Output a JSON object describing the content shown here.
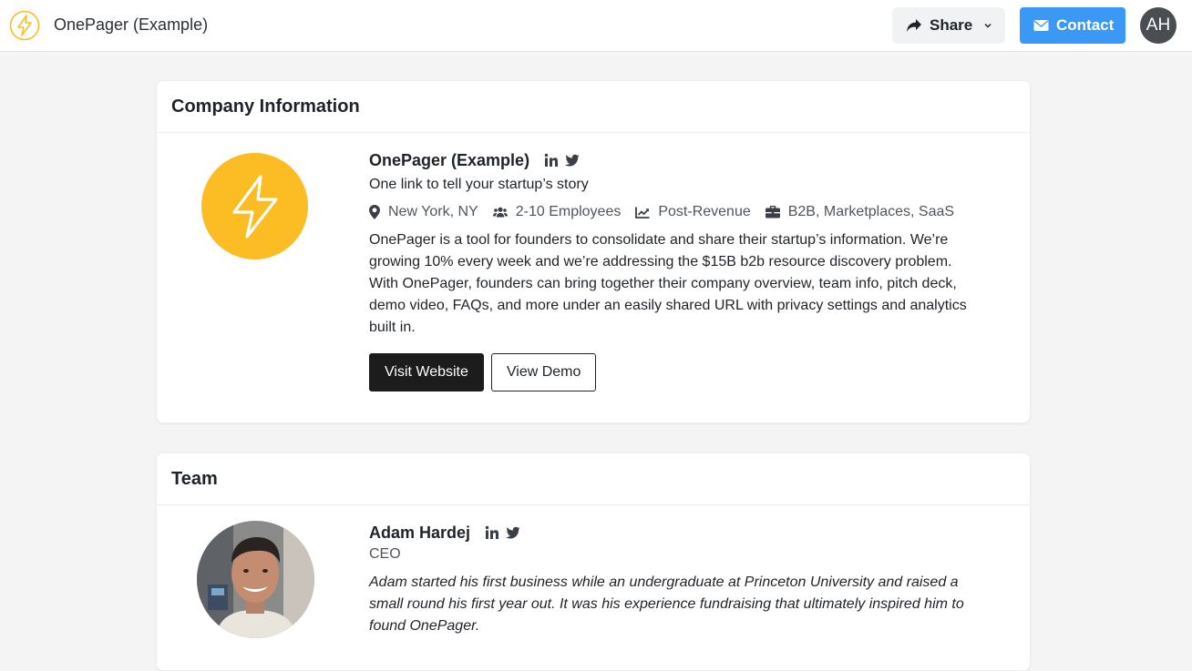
{
  "header": {
    "brand_name": "OnePager (Example)",
    "share_label": "Share",
    "contact_label": "Contact",
    "avatar_initials": "AH"
  },
  "company": {
    "section_title": "Company Information",
    "name": "OnePager (Example)",
    "tagline": "One link to tell your startup’s story",
    "location": "New York, NY",
    "employees": "2-10 Employees",
    "stage": "Post-Revenue",
    "industries": "B2B, Marketplaces, SaaS",
    "description": "OnePager is a tool for founders to consolidate and share their startup’s information. We’re growing 10% every week and we’re addressing the $15B b2b resource discovery problem. With OnePager, founders can bring together their company overview, team info, pitch deck, demo video, FAQs, and more under an easily shared URL with privacy settings and analytics built in.",
    "visit_website_label": "Visit Website",
    "view_demo_label": "View Demo"
  },
  "team": {
    "section_title": "Team",
    "members": [
      {
        "name": "Adam Hardej",
        "role": "CEO",
        "bio": "Adam started his first business while an undergraduate at Princeton University and raised a small round his first year out. It was his experience fundraising that ultimately inspired him to found OnePager."
      }
    ]
  },
  "colors": {
    "brand_yellow": "#fbbd23",
    "contact_blue": "#3b99f6",
    "primary_dark": "#1c1c1c",
    "background": "#f4f4f5"
  },
  "icons": [
    "bolt-icon",
    "share-icon",
    "chevron-down-icon",
    "mail-icon",
    "linkedin-icon",
    "twitter-icon",
    "map-pin-icon",
    "users-icon",
    "chart-line-icon",
    "briefcase-icon"
  ]
}
